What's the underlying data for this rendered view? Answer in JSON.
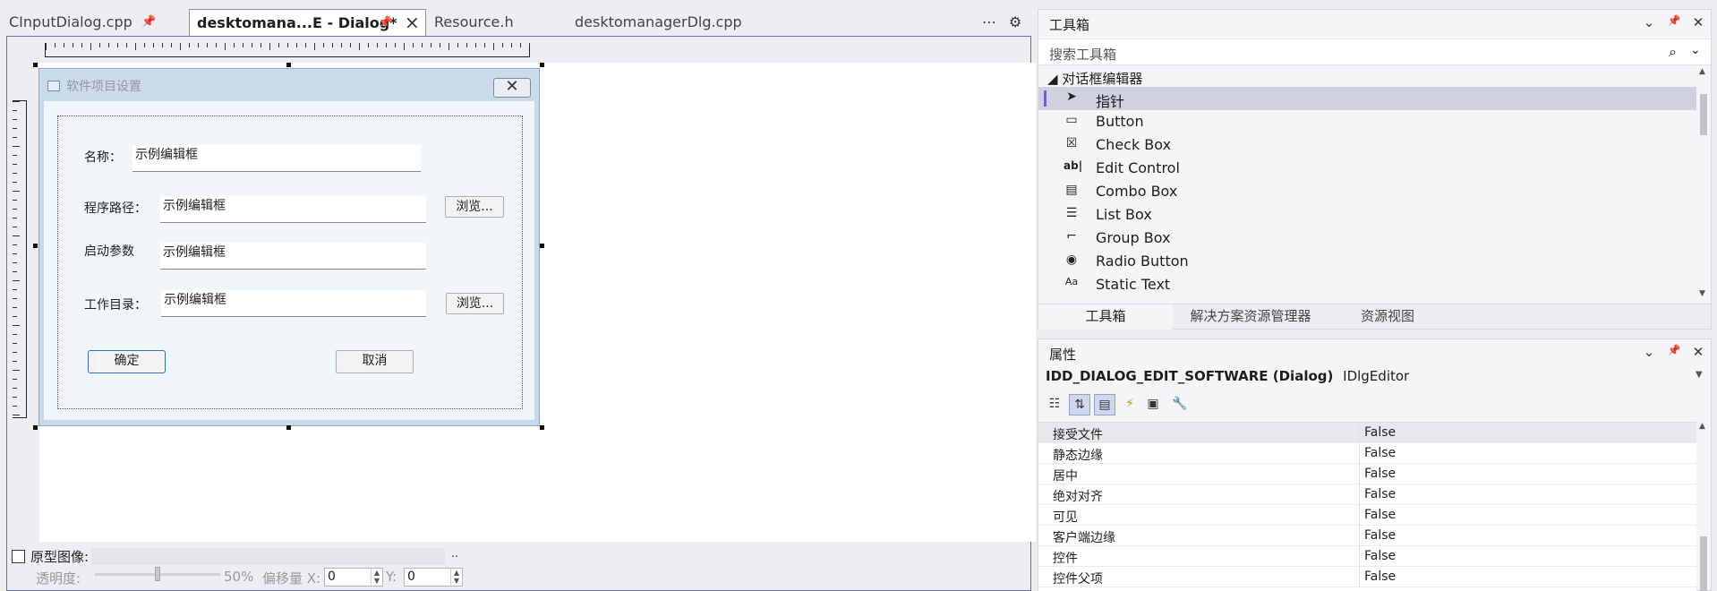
{
  "tabs": [
    {
      "label": "CInputDialog.cpp",
      "active": false,
      "pinned": true
    },
    {
      "label": "desktomana...E - Dialog*",
      "active": true,
      "pinned": true,
      "closable": true
    },
    {
      "label": "Resource.h",
      "active": false
    },
    {
      "label": "desktomanagerDlg.cpp",
      "active": false
    }
  ],
  "tabstrip_icons": {
    "more": "⋯",
    "settings": "⚙"
  },
  "dialog": {
    "title": "软件项目设置",
    "close_glyph": "✕",
    "fields": [
      {
        "label": "名称：",
        "value": "示例编辑框"
      },
      {
        "label": "程序路径：",
        "value": "示例编辑框",
        "browse": "浏览..."
      },
      {
        "label": "启动参数",
        "value": "示例编辑框"
      },
      {
        "label": "工作目录：",
        "value": "示例编辑框",
        "browse": "浏览..."
      }
    ],
    "ok": "确定",
    "cancel": "取消"
  },
  "bottom_bar": {
    "proto_label": "原型图像:",
    "proto_browse": "..",
    "opacity_label": "透明度:",
    "opacity_value": "50%",
    "opacity_fraction": 0.5,
    "offset_label": "偏移量 X:",
    "offset_x": "0",
    "y_label": "Y:",
    "offset_y": "0"
  },
  "toolbox": {
    "title": "工具箱",
    "search_placeholder": "搜索工具箱",
    "group": "对话框编辑器",
    "items": [
      {
        "icon": "pointer-icon",
        "glyph": "➤",
        "label": "指针",
        "selected": true
      },
      {
        "icon": "button-icon",
        "glyph": "▭",
        "label": "Button"
      },
      {
        "icon": "checkbox-icon",
        "glyph": "☒",
        "label": "Check Box"
      },
      {
        "icon": "edit-control-icon",
        "glyph": "ab|",
        "label": "Edit Control"
      },
      {
        "icon": "combo-box-icon",
        "glyph": "▤",
        "label": "Combo Box"
      },
      {
        "icon": "list-box-icon",
        "glyph": "☰",
        "label": "List Box"
      },
      {
        "icon": "group-box-icon",
        "glyph": "⌐",
        "label": "Group Box"
      },
      {
        "icon": "radio-button-icon",
        "glyph": "◉",
        "label": "Radio Button"
      },
      {
        "icon": "static-text-icon",
        "glyph": "Aa",
        "label": "Static Text"
      }
    ],
    "tabs": [
      "工具箱",
      "解决方案资源管理器",
      "资源视图"
    ]
  },
  "properties": {
    "title": "属性",
    "object_name": "IDD_DIALOG_EDIT_SOFTWARE (Dialog)",
    "object_type": "IDlgEditor",
    "rows": [
      {
        "name": "接受文件",
        "value": "False"
      },
      {
        "name": "静态边缘",
        "value": "False"
      },
      {
        "name": "居中",
        "value": "False"
      },
      {
        "name": "绝对对齐",
        "value": "False"
      },
      {
        "name": "可见",
        "value": "False"
      },
      {
        "name": "客户端边缘",
        "value": "False"
      },
      {
        "name": "控件",
        "value": "False"
      },
      {
        "name": "控件父项",
        "value": "False"
      }
    ]
  },
  "panel_buttons": {
    "dropdown": "⌄",
    "pin": "📌",
    "close": "✕"
  }
}
